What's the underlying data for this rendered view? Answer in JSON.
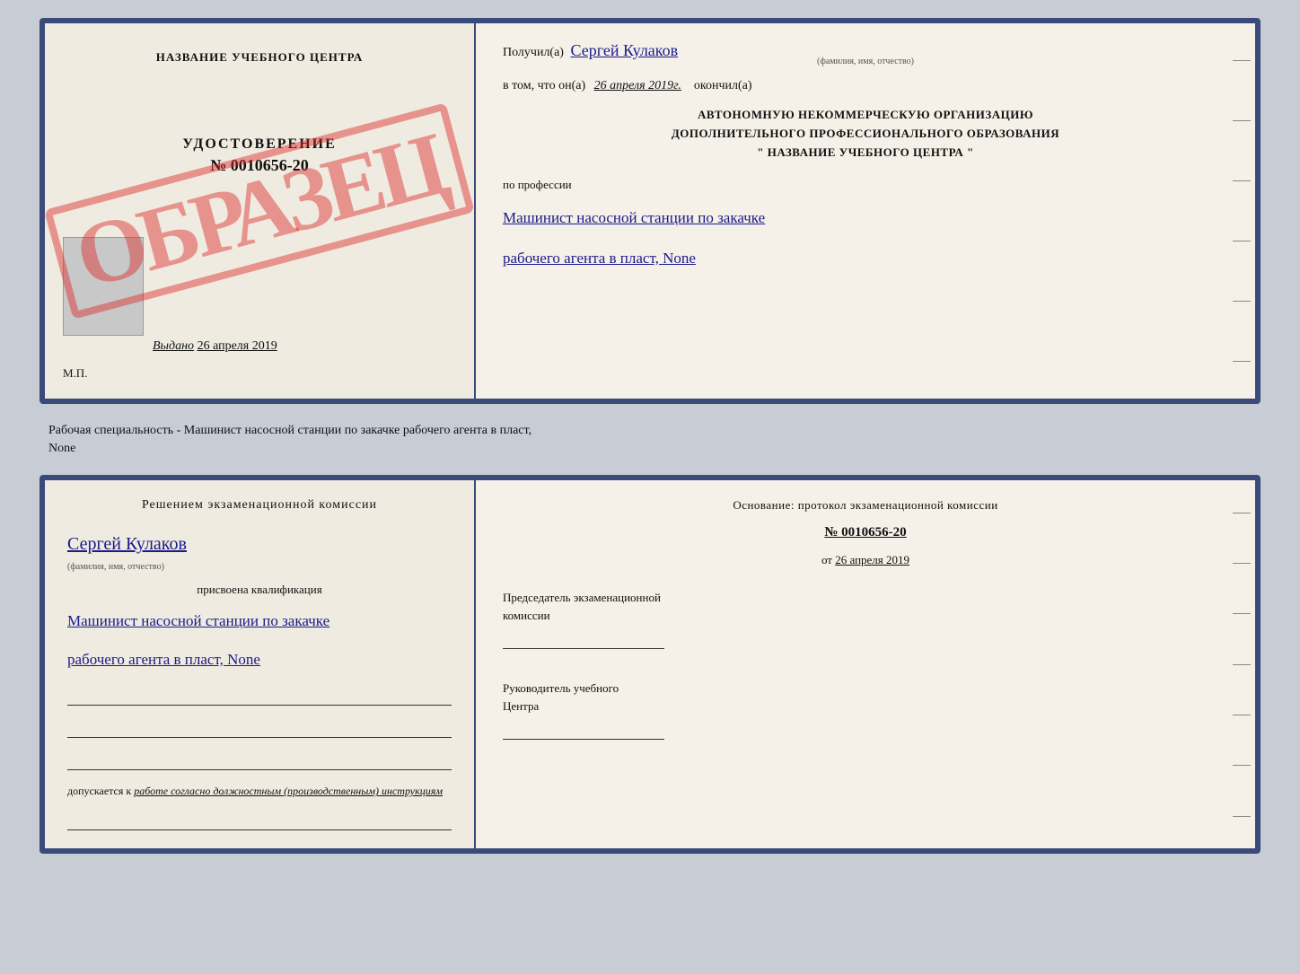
{
  "top_doc": {
    "left": {
      "center_name": "НАЗВАНИЕ УЧЕБНОГО ЦЕНТРА",
      "stamp_text": "ОБРАЗЕЦ",
      "udostoverenie_title": "УДОСТОВЕРЕНИЕ",
      "udostoverenie_num": "№ 0010656-20",
      "vydano_prefix": "Выдано",
      "vydano_date": "26 апреля 2019",
      "mp_label": "М.П."
    },
    "right": {
      "received_prefix": "Получил(а)",
      "received_name": "Сергей Кулаков",
      "fio_label": "(фамилия, имя, отчество)",
      "date_prefix": "в том, что он(а)",
      "date_val": "26 апреля 2019г.",
      "finished_label": "окончил(а)",
      "org_line1": "АВТОНОМНУЮ НЕКОММЕРЧЕСКУЮ ОРГАНИЗАЦИЮ",
      "org_line2": "ДОПОЛНИТЕЛЬНОГО ПРОФЕССИОНАЛЬНОГО ОБРАЗОВАНИЯ",
      "org_line3": "\"  НАЗВАНИЕ УЧЕБНОГО ЦЕНТРА  \"",
      "profession_label": "по профессии",
      "profession_line1": "Машинист насосной станции по закачке",
      "profession_line2": "рабочего агента в пласт, None"
    }
  },
  "separator": {
    "text1": "Рабочая специальность - Машинист насосной станции по закачке рабочего агента в пласт,",
    "text2": "None"
  },
  "bottom_doc": {
    "left": {
      "commission_title": "Решением экзаменационной комиссии",
      "person_name": "Сергей Кулаков",
      "fio_label": "(фамилия, имя, отчество)",
      "assigned_label": "присвоена квалификация",
      "qual_line1": "Машинист насосной станции по закачке",
      "qual_line2": "рабочего агента в пласт, None",
      "допускается_prefix": "допускается к",
      "допускается_italic": "работе согласно должностным (производственным) инструкциям"
    },
    "right": {
      "osnov_title": "Основание: протокол экзаменационной комиссии",
      "protocol_num": "№ 0010656-20",
      "date_prefix": "от",
      "date_val": "26 апреля 2019",
      "chairman_label1": "Председатель экзаменационной",
      "chairman_label2": "комиссии",
      "head_label1": "Руководитель учебного",
      "head_label2": "Центра"
    }
  }
}
